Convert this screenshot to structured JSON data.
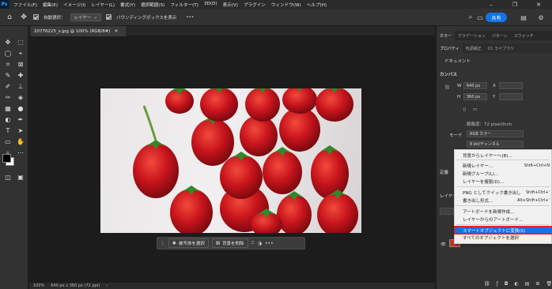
{
  "app": {
    "logo": "Ps"
  },
  "menubar": [
    "ファイル(F)",
    "編集(E)",
    "イメージ(I)",
    "レイヤー(L)",
    "書式(Y)",
    "選択範囲(S)",
    "フィルター(T)",
    "3D(D)",
    "表示(V)",
    "プラグイン",
    "ウィンドウ(W)",
    "ヘルプ(H)"
  ],
  "options": {
    "auto_select": "自動選択：",
    "target": "レイヤー",
    "transform_label": "バウンディングボックスを表示",
    "share": "共有"
  },
  "document": {
    "tab_title": "20776225_s.jpg @ 100% (RGB/8#)"
  },
  "context_bar": {
    "select_subject": "被写体を選択",
    "remove_bg": "背景を削除",
    "more": "•••"
  },
  "status": {
    "zoom": "100%",
    "size": "640 px x 360 px (72 ppi)"
  },
  "panel": {
    "tabs_top": [
      "カラー",
      "グラデーション",
      "パターン",
      "スウォッチ"
    ],
    "tabs_props": [
      "プロパティ",
      "色調補正",
      "CC ライブラリ"
    ],
    "doc_label": "ドキュメント",
    "canvas_section": "カンバス",
    "w_label": "W",
    "w_value": "640 px",
    "x_label": "X",
    "h_label": "H",
    "h_value": "360 px",
    "y_label": "Y",
    "resolution": "解像度：72 pixel/inch",
    "mode_label": "モード",
    "mode_value": "RGB カラー",
    "depth": "8 bit/チャンネル",
    "layers_label": "レイヤー",
    "section2": "定義"
  },
  "context_menu": {
    "items": [
      {
        "label": "背景からレイヤーへ(B)...",
        "shortcut": ""
      },
      {
        "label": "新規レイヤー...",
        "shortcut": "Shift+Ctrl+N"
      },
      {
        "label": "新規グループ(L)...",
        "shortcut": ""
      },
      {
        "label": "レイヤーを複製(D)...",
        "shortcut": ""
      },
      {
        "label": "PNG としてクイック書き出し",
        "shortcut": "Shift+Ctrl+'"
      },
      {
        "label": "書き出し形式...",
        "shortcut": "Alt+Shift+Ctrl+'"
      },
      {
        "label": "アートボードを新規作成...",
        "shortcut": ""
      },
      {
        "label": "レイヤーからのアートボード...",
        "shortcut": ""
      },
      {
        "label": "スマートオブジェクトに変換(S)",
        "shortcut": ""
      },
      {
        "label": "すべてのオブジェクトを選択",
        "shortcut": ""
      }
    ]
  },
  "colors": {
    "accent": "#1473e6",
    "highlight_border": "#e0232b",
    "strawberry": "#c8141c"
  }
}
